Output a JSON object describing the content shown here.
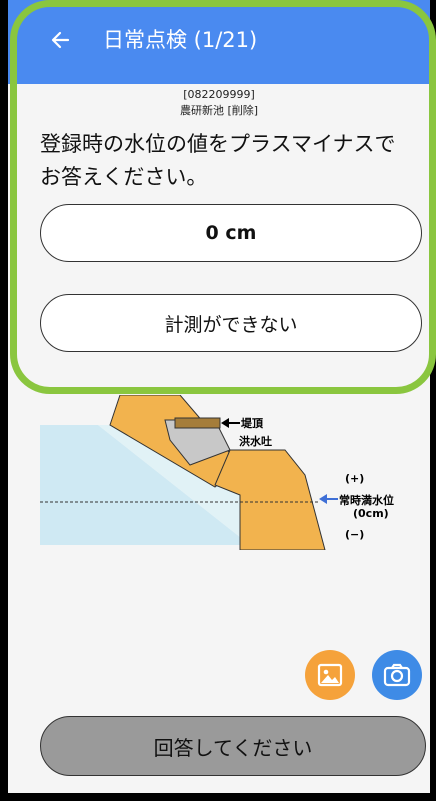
{
  "header": {
    "title": "日常点検 (1/21)",
    "back_icon": "arrow-left-icon",
    "bg_color": "#4a8af0"
  },
  "facility": {
    "id": "[082209999]",
    "name": "農研新池 [削除]"
  },
  "question": {
    "text_line1": "登録時の水位の値をプラスマイナスで",
    "text_line2": "お答えください。"
  },
  "answer": {
    "value": "0 cm",
    "cannot_measure_label": "計測ができない"
  },
  "diagram": {
    "labels": {
      "crest": "堤頂",
      "spillway": "洪水吐",
      "plus": "(+)",
      "normal_level": "常時満水位",
      "zero": "(0cm)",
      "minus": "(−)"
    }
  },
  "actions": {
    "photo_icon": "image-icon",
    "camera_icon": "camera-icon",
    "submit_label": "回答してください"
  },
  "colors": {
    "highlight": "#8ac63f",
    "photo_fab": "#f5a23b",
    "camera_fab": "#3e8be6"
  }
}
